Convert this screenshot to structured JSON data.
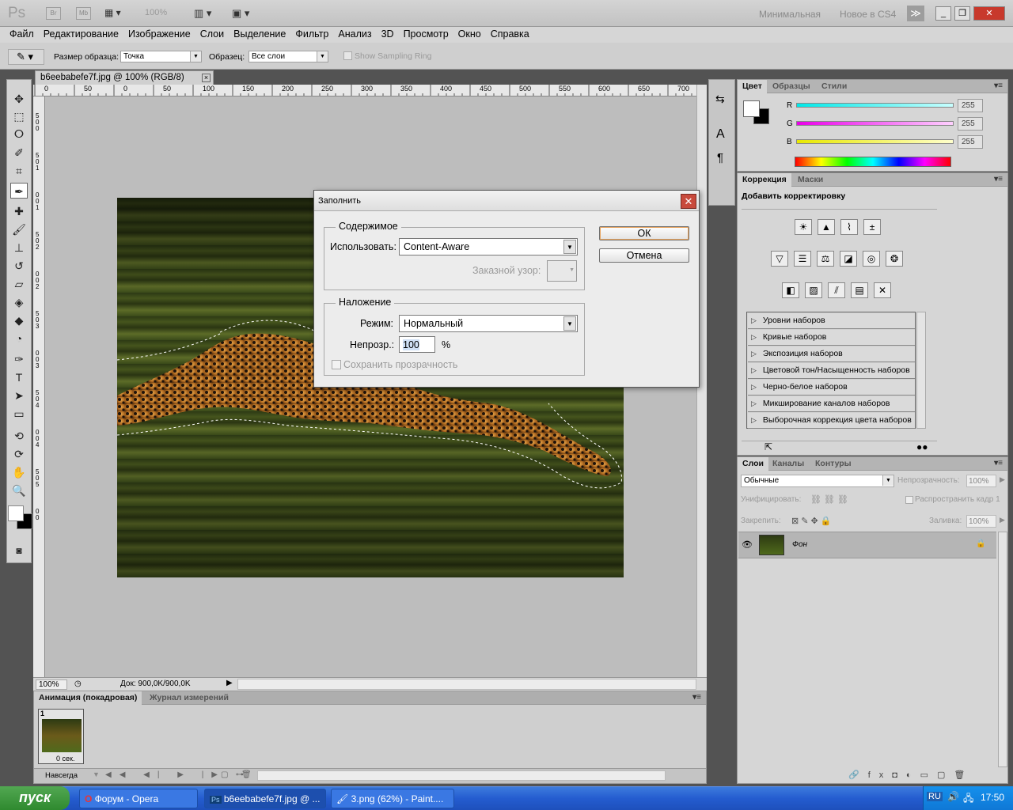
{
  "app": {
    "logo": "Ps",
    "small_buttons": [
      "Br",
      "Mb"
    ],
    "zoom_display": "100%",
    "workspaces": [
      "Минимальная",
      "Новое в CS4"
    ],
    "more_symbol": "≫",
    "window_buttons": [
      "_",
      "❐",
      "✕"
    ]
  },
  "menu": [
    "Файл",
    "Редактирование",
    "Изображение",
    "Слои",
    "Выделение",
    "Фильтр",
    "Анализ",
    "3D",
    "Просмотр",
    "Окно",
    "Справка"
  ],
  "options": {
    "sample_size_label": "Размер образца:",
    "sample_size_value": "Точка",
    "sample_label": "Образец:",
    "sample_value": "Все слои",
    "sampling_ring": "Show Sampling Ring"
  },
  "document": {
    "tab_title": "b6eebabefe7f.jpg @ 100% (RGB/8)",
    "close": "×",
    "ruler_h": [
      "0",
      "50",
      "0",
      "50",
      "100",
      "150",
      "200",
      "250",
      "300",
      "350",
      "400",
      "450",
      "500",
      "550",
      "600",
      "650",
      "700"
    ],
    "ruler_v": [
      "5",
      "0",
      "0",
      "5",
      "0",
      "1",
      "0",
      "0",
      "1",
      "5",
      "0",
      "2",
      "0",
      "0",
      "2",
      "5",
      "0",
      "3",
      "0",
      "0",
      "3",
      "5",
      "0",
      "4",
      "0",
      "0",
      "4",
      "5",
      "0",
      "5",
      "0",
      "0"
    ],
    "status_zoom": "100%",
    "status_doc": "Док: 900,0K/900,0K"
  },
  "fill_dialog": {
    "title": "Заполнить",
    "contents_legend": "Содержимое",
    "use_label": "Использовать:",
    "use_value": "Content-Aware",
    "custom_pattern_label": "Заказной узор:",
    "blending_legend": "Наложение",
    "mode_label": "Режим:",
    "mode_value": "Нормальный",
    "opacity_label": "Непрозр.:",
    "opacity_value": "100",
    "opacity_unit": "%",
    "preserve_label": "Сохранить прозрачность",
    "ok": "ОК",
    "cancel": "Отмена"
  },
  "color_panel": {
    "tabs": [
      "Цвет",
      "Образцы",
      "Стили"
    ],
    "channels": [
      {
        "label": "R",
        "value": "255",
        "color": "#00e8e8"
      },
      {
        "label": "G",
        "value": "255",
        "color": "#e800e8"
      },
      {
        "label": "B",
        "value": "255",
        "color": "#e8e800"
      }
    ]
  },
  "adjustments": {
    "tabs": [
      "Коррекция",
      "Маски"
    ],
    "heading": "Добавить корректировку",
    "presets": [
      "Уровни наборов",
      "Кривые наборов",
      "Экспозиция наборов",
      "Цветовой тон/Насыщенность наборов",
      "Черно-белое наборов",
      "Микширование каналов наборов",
      "Выборочная коррекция цвета наборов"
    ]
  },
  "layers": {
    "tabs": [
      "Слои",
      "Каналы",
      "Контуры"
    ],
    "blend_mode": "Обычные",
    "opacity_label": "Непрозрачность:",
    "opacity_value": "100%",
    "unify_label": "Унифицировать:",
    "propagate_label": "Распространить кадр 1",
    "lock_label": "Закрепить:",
    "fill_label": "Заливка:",
    "fill_value": "100%",
    "layer_name": "Фон",
    "footer_icons": [
      "🔗",
      "fx",
      "◘",
      "◐",
      "▭",
      "▢",
      "🗑"
    ]
  },
  "animation": {
    "tabs": [
      "Анимация (покадровая)",
      "Журнал измерений"
    ],
    "frame_number": "1",
    "frame_delay": "0 сек.",
    "loop": "Навсегда"
  },
  "taskbar": {
    "start": "пуск",
    "tasks": [
      "Форум - Opera",
      "b6eebabefe7f.jpg @ ...",
      "3.png (62%) - Paint...."
    ],
    "lang": "RU",
    "time": "17:50"
  }
}
